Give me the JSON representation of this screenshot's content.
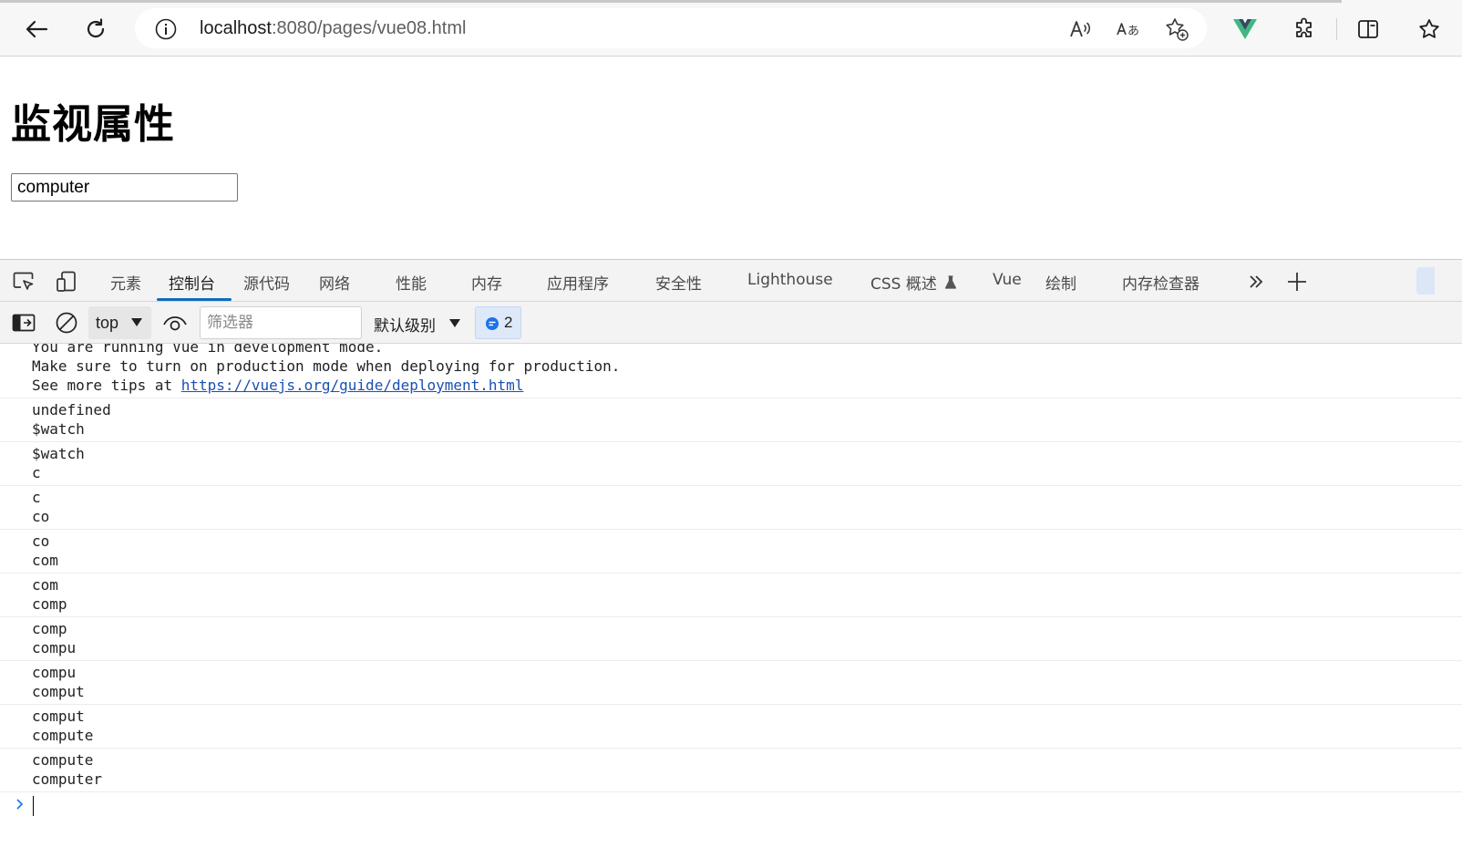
{
  "browser": {
    "url_host": "localhost",
    "url_rest": ":8080/pages/vue08.html",
    "icons": [
      "back-icon",
      "refresh-icon",
      "info-icon",
      "read-aloud-icon",
      "translate-icon",
      "add-favorite-icon",
      "vue-devtools-icon",
      "extensions-icon",
      "split-screen-icon",
      "favorites-icon"
    ]
  },
  "page": {
    "title": "监视属性",
    "input_value": "computer"
  },
  "devtools": {
    "tabs": [
      {
        "label": "元素"
      },
      {
        "label": "控制台",
        "active": true
      },
      {
        "label": "源代码"
      },
      {
        "label": "网络"
      },
      {
        "label": "性能"
      },
      {
        "label": "内存"
      },
      {
        "label": "应用程序"
      },
      {
        "label": "安全性"
      },
      {
        "label": "Lighthouse"
      },
      {
        "label": "CSS 概述"
      },
      {
        "label": "Vue"
      },
      {
        "label": "绘制"
      },
      {
        "label": "内存检查器"
      }
    ],
    "console_bar": {
      "context": "top",
      "filter_placeholder": "筛选器",
      "level": "默认级别",
      "message_count": "2"
    },
    "console": {
      "entries": [
        {
          "lines": [
            "You are running Vue in development mode.",
            "Make sure to turn on production mode when deploying for production."
          ],
          "tip_prefix": "See more tips at ",
          "tip_link": "https://vuejs.org/guide/deployment.html"
        },
        {
          "lines": [
            "undefined",
            "$watch"
          ]
        },
        {
          "lines": [
            "$watch",
            "c"
          ]
        },
        {
          "lines": [
            "c",
            "co"
          ]
        },
        {
          "lines": [
            "co",
            "com"
          ]
        },
        {
          "lines": [
            "com",
            "comp"
          ]
        },
        {
          "lines": [
            "comp",
            "compu"
          ]
        },
        {
          "lines": [
            "compu",
            "comput"
          ]
        },
        {
          "lines": [
            "comput",
            "compute"
          ]
        },
        {
          "lines": [
            "compute",
            "computer"
          ]
        }
      ]
    },
    "accent_color": "#0f6cbd"
  }
}
